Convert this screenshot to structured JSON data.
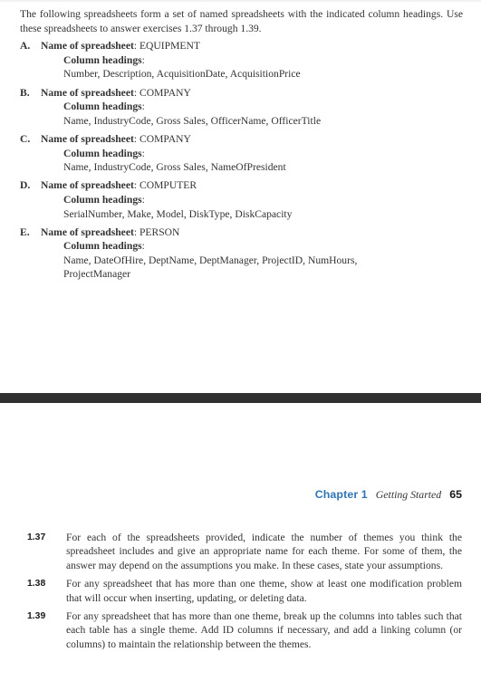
{
  "intro": {
    "text": "The following spreadsheets form a set of named spreadsheets with the indicated column headings. Use these spreadsheets to answer exercises 1.37 through 1.39."
  },
  "labels": {
    "name_of_spreadsheet": "Name of spreadsheet",
    "colon": ":",
    "column_headings": "Column headings",
    "column_headings_colon": ":"
  },
  "spreadsheets": [
    {
      "marker": "A.",
      "name": "EQUIPMENT",
      "columns": "Number, Description, AcquisitionDate, AcquisitionPrice"
    },
    {
      "marker": "B.",
      "name": "COMPANY",
      "columns": "Name, IndustryCode, Gross Sales, OfficerName, OfficerTitle"
    },
    {
      "marker": "C.",
      "name": "COMPANY",
      "columns": "Name, IndustryCode, Gross Sales, NameOfPresident"
    },
    {
      "marker": "D.",
      "name": "COMPUTER",
      "columns": "SerialNumber, Make, Model, DiskType, DiskCapacity"
    },
    {
      "marker": "E.",
      "name": "PERSON",
      "columns": "Name, DateOfHire, DeptName, DeptManager, ProjectID, NumHours, ProjectManager"
    }
  ],
  "footer": {
    "chapter": "Chapter 1",
    "title": "Getting Started",
    "page": "65",
    "chapter_color": "#2E75B6"
  },
  "separator": {
    "color": "#303030"
  },
  "exercises": [
    {
      "number": "1.37",
      "text": "For each of the spreadsheets provided, indicate the number of themes you think the spreadsheet includes and give an appropriate name for each theme. For some of them, the answer may depend on the assumptions you make. In these cases, state your assumptions."
    },
    {
      "number": "1.38",
      "text": "For any spreadsheet that has more than one theme, show at least one modification problem that will occur when inserting, updating, or deleting data."
    },
    {
      "number": "1.39",
      "text": "For any spreadsheet that has more than one theme, break up the columns into tables such that each table has a single theme. Add ID columns if necessary, and add a linking column (or columns) to maintain the relationship between the themes."
    }
  ]
}
